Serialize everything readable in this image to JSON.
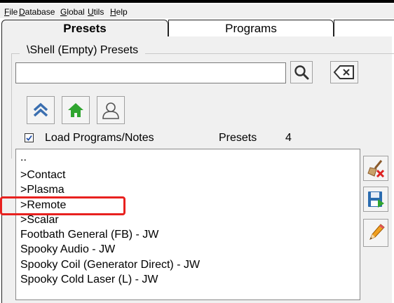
{
  "menu": [
    "File",
    "Database",
    "Global",
    "Utils",
    "Help"
  ],
  "tabs": [
    {
      "label": "Presets",
      "active": true
    },
    {
      "label": "Programs",
      "active": false
    }
  ],
  "group_title": "\\Shell (Empty) Presets",
  "search": {
    "value": "",
    "placeholder": ""
  },
  "icons": {
    "search": "magnifier-icon",
    "clear": "backspace-clear-icon",
    "up": "double-chevron-up-icon",
    "home": "home-icon",
    "user": "user-icon",
    "delete": "broom-delete-icon",
    "save": "floppy-save-icon",
    "edit": "pencil-edit-icon"
  },
  "load_programs": {
    "label": "Load Programs/Notes",
    "checked": true
  },
  "presets_count": {
    "label": "Presets",
    "value": "4"
  },
  "list_items": [
    "..",
    ">Contact",
    ">Plasma",
    ">Remote",
    ">Scalar",
    "Footbath General (FB) - JW",
    "Spooky Audio - JW",
    "Spooky Coil (Generator Direct) - JW",
    "Spooky Cold Laser (L) - JW"
  ],
  "colors": {
    "highlight": "#e8211f",
    "home": "#2fa52f",
    "nav": "#3b6fb0"
  }
}
